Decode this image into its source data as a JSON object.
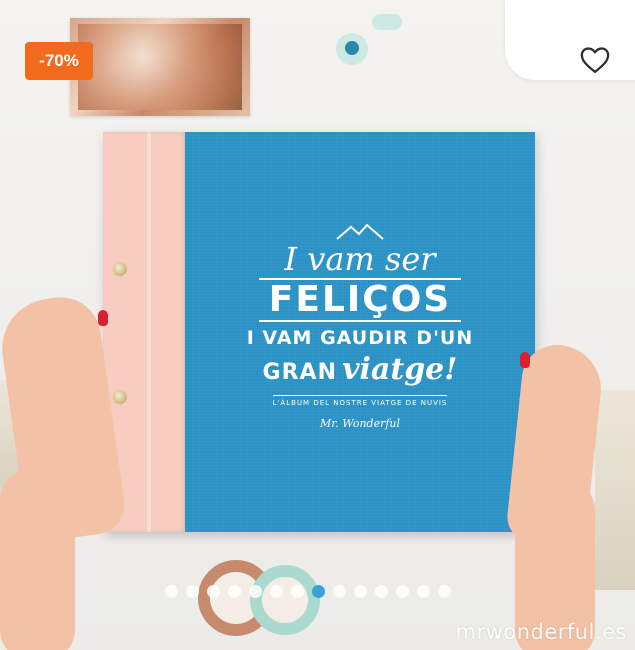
{
  "discount_badge": {
    "text": "-70%",
    "color": "#f26b1d"
  },
  "favorite": {
    "icon": "heart-outline-icon"
  },
  "book": {
    "line1": "I vam ser",
    "line2": "FELIÇOS",
    "line3": "I VAM GAUDIR D'UN",
    "line4a": "GRAN",
    "line4b": "viatge!",
    "subtitle": "L'ÀLBUM DEL NOSTRE VIATGE DE NUVIS",
    "brand": "Mr. Wonderful",
    "cover_color": "#2d94c8",
    "spine_color": "#f6cdc0"
  },
  "carousel": {
    "count": 14,
    "active_index": 7,
    "active_color": "#3ba3d6"
  },
  "watermark": "mrwonderful.es"
}
